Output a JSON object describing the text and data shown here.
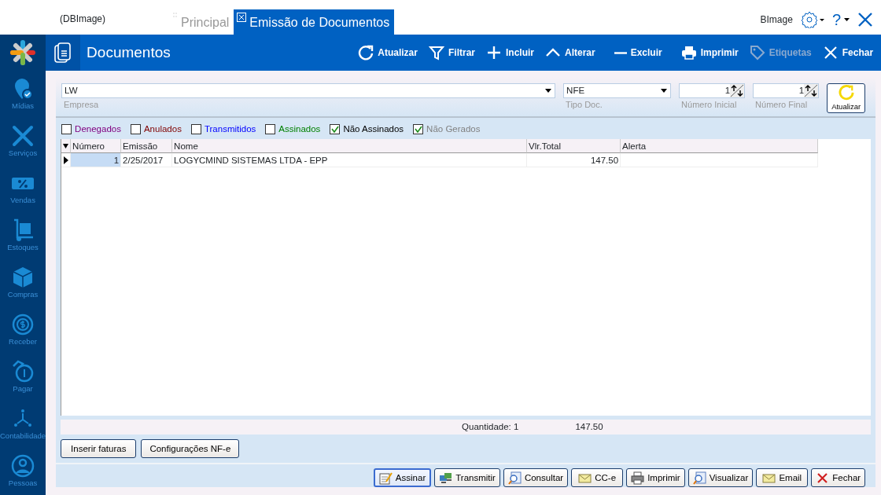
{
  "header": {
    "app_label": "(DBImage)",
    "tabs": [
      {
        "label": "Principal",
        "selected": false
      },
      {
        "label": "Emissão de Documentos",
        "selected": true
      }
    ],
    "user_label": "BImage",
    "help_label": "?"
  },
  "sidebar": {
    "items": [
      {
        "label": "Mídias"
      },
      {
        "label": "Serviços"
      },
      {
        "label": "Vendas"
      },
      {
        "label": "Estoques"
      },
      {
        "label": "Compras"
      },
      {
        "label": "Receber"
      },
      {
        "label": "Pagar"
      },
      {
        "label": "Contabilidade"
      },
      {
        "label": "Pessoas"
      }
    ]
  },
  "toolbar": {
    "title": "Documentos",
    "actions": [
      {
        "label": "Atualizar",
        "disabled": false
      },
      {
        "label": "Filtrar",
        "disabled": false
      },
      {
        "label": "Incluir",
        "disabled": false
      },
      {
        "label": "Alterar",
        "disabled": false
      },
      {
        "label": "Excluir",
        "disabled": false
      },
      {
        "label": "Imprimir",
        "disabled": false
      },
      {
        "label": "Etiquetas",
        "disabled": true
      },
      {
        "label": "Fechar",
        "disabled": false
      }
    ]
  },
  "filters": {
    "fields": [
      {
        "kind": "combo",
        "value": "LW",
        "caption": "Empresa"
      },
      {
        "kind": "combo",
        "value": "NFE",
        "caption": "Tipo Doc."
      },
      {
        "kind": "spin",
        "value": "1",
        "caption": "Número Inicial"
      },
      {
        "kind": "spin",
        "value": "1",
        "caption": "Número Final"
      }
    ],
    "refresh_button": "Atualizar",
    "checkboxes": [
      {
        "label": "Denegados",
        "checked": false,
        "color": "#800080"
      },
      {
        "label": "Anulados",
        "checked": false,
        "color": "#800000"
      },
      {
        "label": "Transmitidos",
        "checked": false,
        "color": "#0000ff"
      },
      {
        "label": "Assinados",
        "checked": false,
        "color": "#008000"
      },
      {
        "label": "Não Assinados",
        "checked": true,
        "color": "#000000"
      },
      {
        "label": "Não Gerados",
        "checked": true,
        "color": "#808080"
      }
    ]
  },
  "table": {
    "columns": [
      "Número",
      "Emissão",
      "Nome",
      "Vlr.Total",
      "Alerta"
    ],
    "rows": [
      {
        "selected": true,
        "cells": [
          "1",
          "2/25/2017",
          "LOGYCMIND SISTEMAS LTDA - EPP",
          "147.50"
        ]
      }
    ]
  },
  "totals": {
    "quantity": "Quantidade: 1",
    "total": "147.50"
  },
  "left_buttons": [
    "Inserir faturas",
    "Configurações NF-e"
  ],
  "bottom_buttons": [
    {
      "label": "Assinar",
      "focused": true
    },
    {
      "label": "Transmitir",
      "focused": false
    },
    {
      "label": "Consultar",
      "focused": false
    },
    {
      "label": "CC-e",
      "focused": false
    },
    {
      "label": "Imprimir",
      "focused": false
    },
    {
      "label": "Visualizar",
      "focused": false
    },
    {
      "label": "Email",
      "focused": false
    },
    {
      "label": "Fechar",
      "focused": false
    }
  ]
}
